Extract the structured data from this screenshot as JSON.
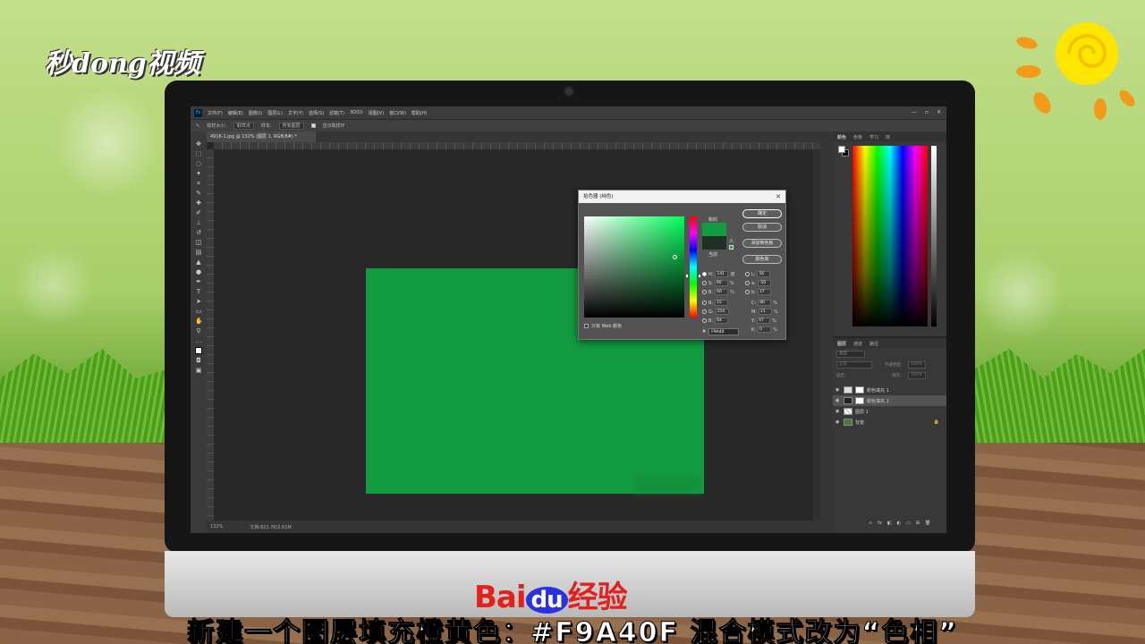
{
  "branding": {
    "site_logo": "秒dong视频",
    "baidu_brand": "Bai",
    "baidu_du": "du",
    "baidu_suffix": "经验"
  },
  "subtitle": "新建一个图层填充橙黄色：#F9A40F 混合模式改为“色相”",
  "photoshop": {
    "menu": [
      "文件(F)",
      "编辑(E)",
      "图像(I)",
      "图层(L)",
      "文字(Y)",
      "选择(S)",
      "滤镜(T)",
      "3D(D)",
      "视图(V)",
      "窗口(W)",
      "帮助(H)"
    ],
    "ps_icon": "Ps",
    "window_controls": [
      "—",
      "▫",
      "✕"
    ],
    "options": {
      "sample_size_label": "取样大小:",
      "sample_size": "取样点",
      "sample_label": "样本:",
      "sample": "所有图层",
      "show_ring": "显示取样环"
    },
    "doc_tab": "4916-1.jpg @ 132% (图层 1, RGB/8#) *",
    "status": {
      "zoom": "132%",
      "doc": "文档:822.7K/2.61M"
    },
    "panel_tabs_top": [
      "颜色",
      "色板",
      "学习",
      "库"
    ],
    "panel_tabs_layers": [
      "图层",
      "通道",
      "路径"
    ],
    "layers_kind_placeholder": "类型",
    "layers_mode": "正常",
    "layers_opacity_label": "不透明度:",
    "layers_opacity": "100%",
    "layers_lock_label": "锁定:",
    "layers_fill_label": "填充:",
    "layers_fill": "100%",
    "layers": [
      {
        "name": "颜色填充 1",
        "selected": false
      },
      {
        "name": "颜色填充 2",
        "selected": true
      },
      {
        "name": "图层 1",
        "selected": false
      },
      {
        "name": "背景",
        "selected": false
      }
    ],
    "layers_bottom_icons": [
      "∞",
      "fx",
      "◧",
      "◐",
      "▭",
      "⊞",
      "🗑"
    ]
  },
  "color_picker": {
    "title": "拾色器 (纯色)",
    "close": "✕",
    "new_label": "新的",
    "current_label": "当前",
    "colors": {
      "new": "#129b41",
      "current": "#1f3024"
    },
    "buttons": {
      "ok": "确定",
      "cancel": "取消",
      "add_swatch": "添加到色板",
      "color_library": "颜色库"
    },
    "web_only": "只有 Web 颜色",
    "fields": {
      "H": {
        "value": "141",
        "unit": "度"
      },
      "S": {
        "value": "90",
        "unit": "%"
      },
      "B": {
        "value": "60",
        "unit": "%"
      },
      "R": {
        "value": "15",
        "unit": ""
      },
      "G": {
        "value": "154",
        "unit": ""
      },
      "B2": {
        "value": "64",
        "unit": ""
      },
      "L": {
        "value": "56",
        "unit": ""
      },
      "a": {
        "value": "-50",
        "unit": ""
      },
      "b": {
        "value": "37",
        "unit": ""
      },
      "C": {
        "value": "80",
        "unit": "%"
      },
      "M": {
        "value": "21",
        "unit": "%"
      },
      "Y": {
        "value": "97",
        "unit": "%"
      },
      "K": {
        "value": "0",
        "unit": "%"
      }
    },
    "labels": {
      "H": "H:",
      "S": "S:",
      "B": "B:",
      "R": "R:",
      "G": "G:",
      "B2": "B:",
      "L": "L:",
      "a": "a:",
      "b": "b:",
      "C": "C:",
      "M": "M:",
      "Y": "Y:",
      "K": "K:"
    },
    "hex_label": "#",
    "hex": "F9A40"
  }
}
